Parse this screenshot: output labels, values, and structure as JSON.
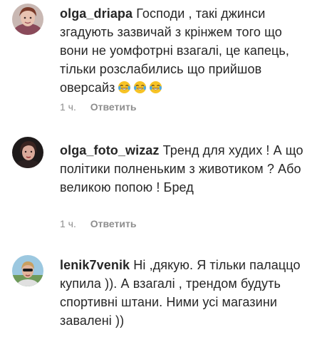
{
  "comments": [
    {
      "username": "olga_driapa",
      "text": "Господи , такі джинси згадують зазвичай з крінжем того що вони не уомфотрні взагалі, це капець, тільки розслабились що прийшов оверсайз",
      "emoji": "face-with-tears-of-joy-icon",
      "emoji_count": 3,
      "time": "1 ч.",
      "reply_label": "Ответить"
    },
    {
      "username": "olga_foto_wizaz",
      "text": "Тренд для худих ! А що політики полненьким з животиком ? Або великою попою ! Бред",
      "time": "1 ч.",
      "reply_label": "Ответить"
    },
    {
      "username": "lenik7venik",
      "text": "Ні ,дякую. Я тільки палаццо купила )). А взагалі , трендом будуть спортивні штани. Ними усі магазини завалені ))"
    }
  ],
  "colors": {
    "text": "#262626",
    "muted": "#8e8e8e",
    "background": "#ffffff"
  }
}
